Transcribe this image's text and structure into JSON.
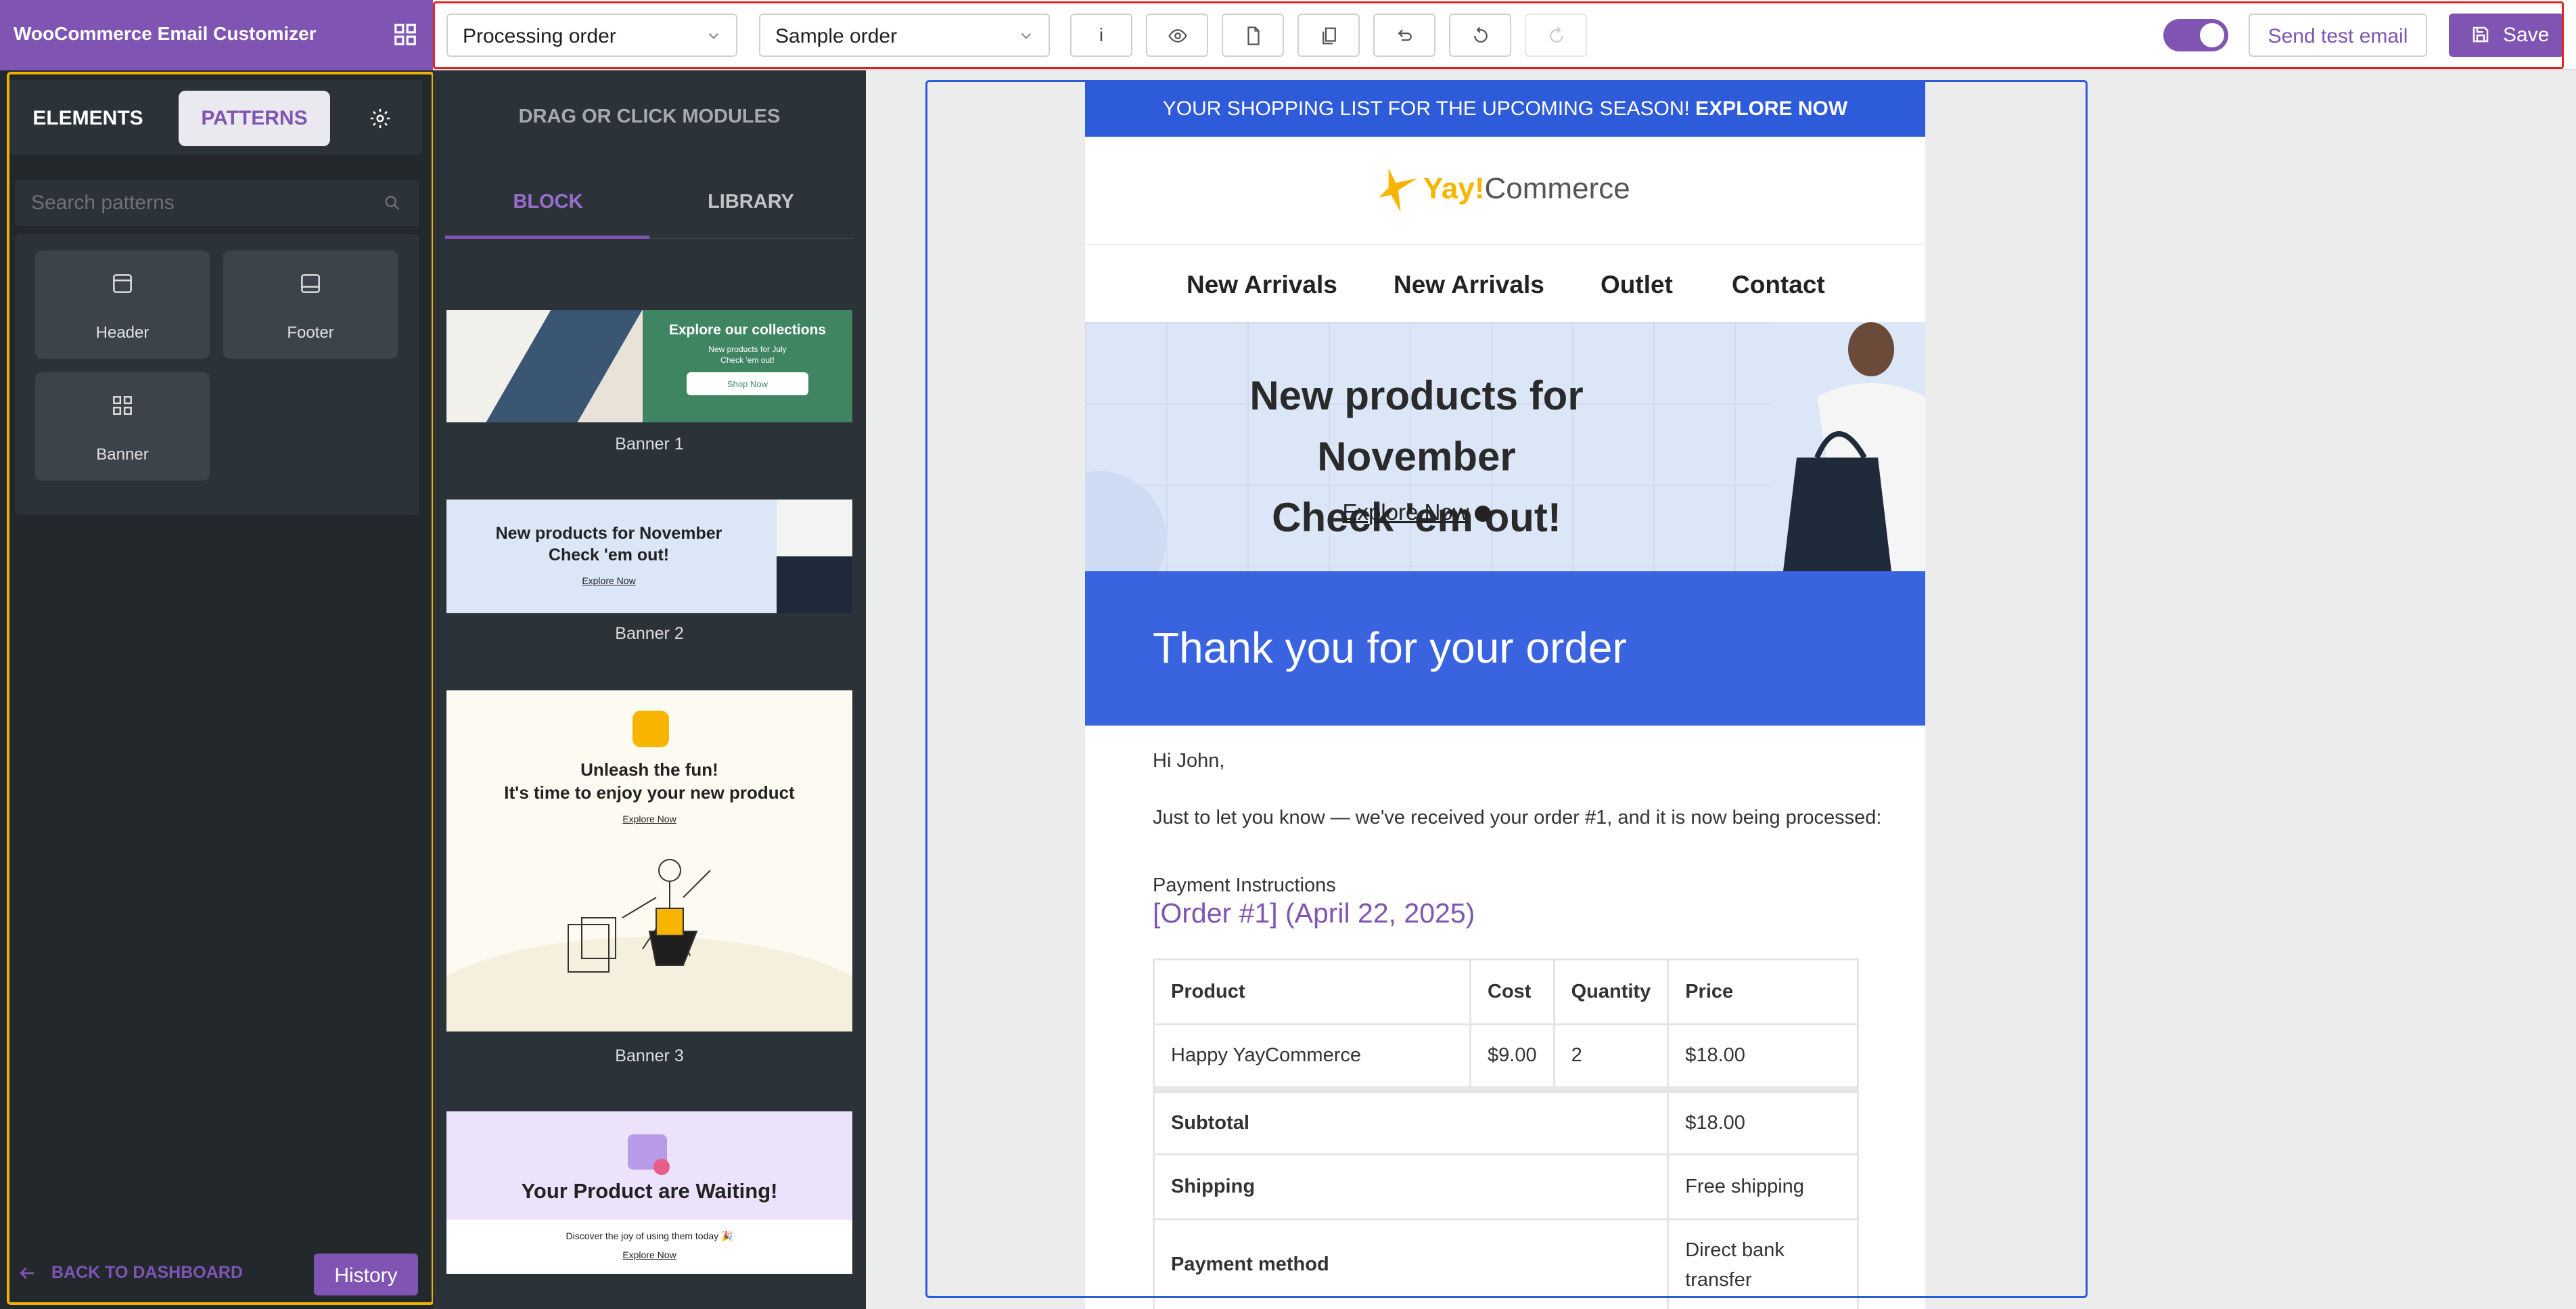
{
  "app": {
    "title": "WooCommerce Email Customizer"
  },
  "toolbar": {
    "email_type": "Processing order",
    "order_select": "Sample order",
    "info_label": "i",
    "send_test_label": "Send test email",
    "save_label": "Save",
    "toggle_on": true,
    "accent_color": "#7f54b3"
  },
  "left_panel": {
    "tabs": {
      "elements": "ELEMENTS",
      "patterns": "PATTERNS"
    },
    "search_placeholder": "Search patterns",
    "patterns": [
      {
        "label": "Header",
        "icon": "header-layout-icon"
      },
      {
        "label": "Footer",
        "icon": "footer-layout-icon"
      },
      {
        "label": "Banner",
        "icon": "grid-icon"
      }
    ],
    "back_label": "BACK TO DASHBOARD",
    "history_label": "History"
  },
  "middle_panel": {
    "heading": "DRAG OR CLICK MODULES",
    "tabs": {
      "block": "BLOCK",
      "library": "LIBRARY"
    },
    "items": [
      {
        "label": "Banner 1",
        "title": "Explore our collections",
        "subtitle_1": "New products for July",
        "subtitle_2": "Check 'em out!",
        "button": "Shop Now"
      },
      {
        "label": "Banner 2",
        "title_1": "New products for November",
        "title_2": "Check 'em out!",
        "link": "Explore Now"
      },
      {
        "label": "Banner 3",
        "title_1": "Unleash the fun!",
        "title_2": "It's time to enjoy your new product",
        "link": "Explore Now"
      },
      {
        "title": "Your Product are Waiting!",
        "subtitle": "Discover the joy of using them today 🎉",
        "link": "Explore Now"
      }
    ]
  },
  "email": {
    "promo_text": "YOUR SHOPPING LIST FOR THE UPCOMING SEASON!",
    "promo_link": "EXPLORE NOW",
    "logo_yay": "Yay!",
    "logo_commerce": "Commerce",
    "nav": [
      "New Arrivals",
      "New Arrivals",
      "Outlet",
      "Contact"
    ],
    "hero_title_1": "New products for November",
    "hero_title_2": "Check 'em out!",
    "hero_link": "Explore Now",
    "heading": "Thank you for your order",
    "greeting": "Hi John,",
    "message": "Just to let you know — we've received your order #1, and it is now being processed:",
    "payment_instructions": "Payment Instructions",
    "order_title": "[Order #1] (April 22, 2025)",
    "table": {
      "headers": [
        "Product",
        "Cost",
        "Quantity",
        "Price"
      ],
      "rows": [
        [
          "Happy YayCommerce",
          "$9.00",
          "2",
          "$18.00"
        ]
      ],
      "totals": [
        {
          "label": "Subtotal",
          "value": "$18.00"
        },
        {
          "label": "Shipping",
          "value": "Free shipping"
        },
        {
          "label": "Payment method",
          "value": "Direct bank transfer"
        }
      ]
    },
    "colors": {
      "promo_bg": "#2e5bd9",
      "heading_bg": "#3a63e0",
      "order_link": "#7f54b3"
    }
  }
}
